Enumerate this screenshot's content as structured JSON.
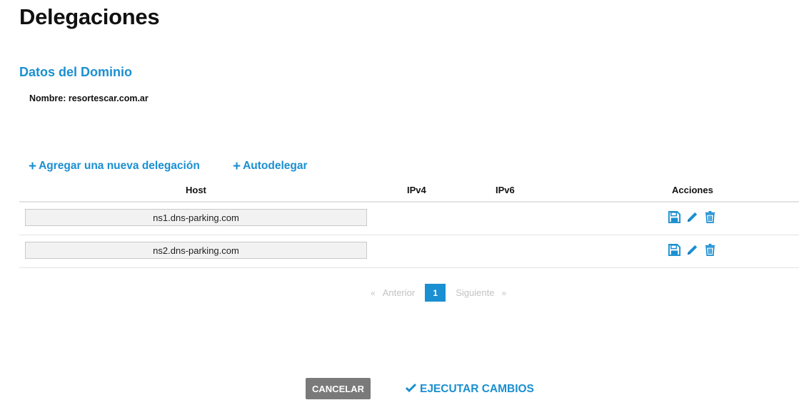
{
  "page": {
    "title": "Delegaciones"
  },
  "domain": {
    "section_title": "Datos del Dominio",
    "name_text": "Nombre: resortescar.com.ar"
  },
  "actions": {
    "add_label": "Agregar una nueva delegación",
    "auto_label": "Autodelegar"
  },
  "table": {
    "headers": {
      "host": "Host",
      "ipv4": "IPv4",
      "ipv6": "IPv6",
      "acciones": "Acciones"
    },
    "rows": [
      {
        "host": "ns1.dns-parking.com",
        "ipv4": "",
        "ipv6": ""
      },
      {
        "host": "ns2.dns-parking.com",
        "ipv4": "",
        "ipv6": ""
      }
    ],
    "row_icons": [
      "save-icon",
      "edit-pencil-icon",
      "trash-icon"
    ]
  },
  "pagination": {
    "prev_arrow": "«",
    "prev_label": "Anterior",
    "current_page": "1",
    "next_label": "Siguiente",
    "next_arrow": "»"
  },
  "footer": {
    "cancel_label": "CANCELAR",
    "execute_label": "EJECUTAR CAMBIOS"
  },
  "colors": {
    "accent": "#1a8fd1",
    "cancel_bg": "#7a7a7a",
    "pagination_muted": "#c2c2c2"
  }
}
